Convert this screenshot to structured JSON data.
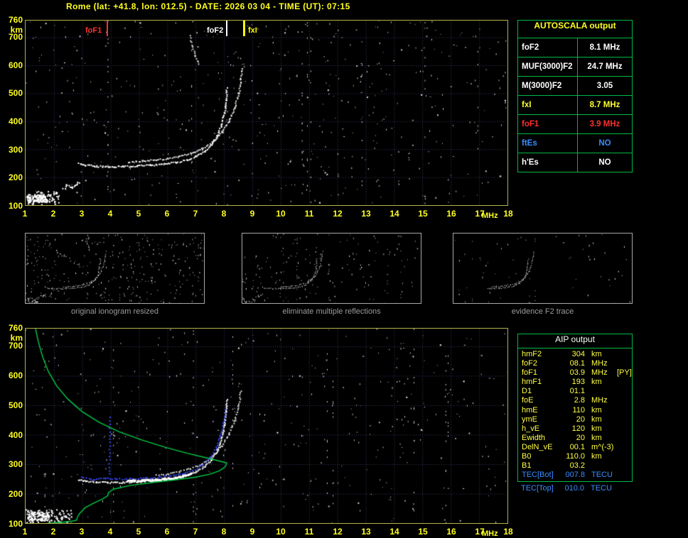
{
  "title": "Rome (lat: +41.8, lon: 012.5) - DATE: 2026 03 04 - TIME (UT): 07:15",
  "colors": {
    "background": "#000000",
    "axis_text": "#ffff21",
    "plot_border": "#b2b24a",
    "grid": "#3a3a66",
    "table_border": "#00b944",
    "caption": "#9c9c9c",
    "trace_white": "#ffffff",
    "trace_blue": "#3b4bff",
    "profile_green": "#00cc44",
    "marker_red": "#ff3030",
    "marker_yellow": "#ffff00",
    "status_blue": "#3a8cff"
  },
  "autoscala_table": {
    "header": "AUTOSCALA output",
    "rows": [
      {
        "label": "foF2",
        "value": "8.1 MHz",
        "color": "#ffffff"
      },
      {
        "label": "MUF(3000)F2",
        "value": "24.7 MHz",
        "color": "#ffffff"
      },
      {
        "label": "M(3000)F2",
        "value": "3.05",
        "color": "#ffffff"
      },
      {
        "label": "fxI",
        "value": "8.7 MHz",
        "color": "#ffff33"
      },
      {
        "label": "foF1",
        "value": "3.9 MHz",
        "color": "#ff3030"
      },
      {
        "label": "ftEs",
        "value": "NO",
        "color": "#3a8cff"
      },
      {
        "label": "h'Es",
        "value": "NO",
        "color": "#ffffff"
      }
    ]
  },
  "aip_table": {
    "header": "AIP output",
    "rows": [
      {
        "name": "hmF2",
        "value": "304",
        "unit": "km"
      },
      {
        "name": "foF2",
        "value": "08.1",
        "unit": "MHz"
      },
      {
        "name": "foF1",
        "value": "03.9",
        "unit": "MHz",
        "note": "[PY]"
      },
      {
        "name": "hmF1",
        "value": "193",
        "unit": "km"
      },
      {
        "name": "D1",
        "value": "01.1",
        "unit": ""
      },
      {
        "name": "foE",
        "value": "2.8",
        "unit": "MHz"
      },
      {
        "name": "hmE",
        "value": "110",
        "unit": "km"
      },
      {
        "name": "ymE",
        "value": "20",
        "unit": "km"
      },
      {
        "name": "h_vE",
        "value": "120",
        "unit": "km"
      },
      {
        "name": "Ewidth",
        "value": "20",
        "unit": "km"
      },
      {
        "name": "DelN_vE",
        "value": "00.1",
        "unit": "m^(-3)"
      },
      {
        "name": "B0",
        "value": "110.0",
        "unit": "km"
      },
      {
        "name": "B1",
        "value": "03.2",
        "unit": ""
      },
      {
        "name": "TEC[Bot]",
        "value": "007.8",
        "unit": "TECU",
        "color": "#3a8cff"
      }
    ],
    "footer_row": {
      "name": "TEC[Top]",
      "value": "010.0",
      "unit": "TECU",
      "color": "#3a8cff"
    }
  },
  "thumbnails": [
    {
      "caption": "original ionogram resized",
      "render": {
        "seed": 11,
        "noise": 300,
        "streaks": 8,
        "exclude_tags": [],
        "min_f": 1,
        "clusters": [
          {
            "f": [
              1.0,
              2.2
            ],
            "h": [
              100,
              150
            ],
            "n": 35,
            "size": 1
          }
        ]
      }
    },
    {
      "caption": "eliminate multiple reflections",
      "render": {
        "seed": 12,
        "noise": 150,
        "streaks": 5,
        "exclude_tags": [
          "echo"
        ],
        "min_f": 1,
        "clusters": [
          {
            "f": [
              1.0,
              2.2
            ],
            "h": [
              100,
              150
            ],
            "n": 18,
            "size": 1
          }
        ]
      }
    },
    {
      "caption": "evidence F2 trace",
      "render": {
        "seed": 13,
        "noise": 55,
        "streaks": 3,
        "exclude_tags": [
          "echo",
          "es"
        ],
        "min_f": 4.2,
        "clusters": []
      }
    }
  ],
  "chart_data": [
    {
      "type": "scatter",
      "name": "scaled ionogram (virtual height vs frequency)",
      "xlabel": "MHz",
      "ylabel": "km",
      "xlim": [
        1,
        18
      ],
      "ylim": [
        100,
        760
      ],
      "x_ticks": [
        1,
        2,
        3,
        4,
        5,
        6,
        7,
        8,
        9,
        10,
        11,
        12,
        13,
        14,
        15,
        16,
        17,
        18
      ],
      "y_ticks": [
        760,
        700,
        600,
        500,
        400,
        300,
        200,
        100
      ],
      "grid": true,
      "markers": [
        {
          "label": "foF1",
          "freq": 3.9,
          "color": "#ff3030",
          "label_dx": -31,
          "width": 2
        },
        {
          "label": "foF2",
          "freq": 8.1,
          "color": "#ffffff",
          "label_dx": -28,
          "width": 2
        },
        {
          "label": "fxI",
          "freq": 8.7,
          "color": "#ffff00",
          "label_dx": 6,
          "width": 3
        }
      ],
      "traces": [
        {
          "tag": "o",
          "name": "F-trace O-mode",
          "color": "#ffffff",
          "size": 2,
          "step": 2.2,
          "jitter": 2,
          "points": [
            [
              2.85,
              250
            ],
            [
              3.1,
              245
            ],
            [
              3.5,
              241
            ],
            [
              3.9,
              239
            ],
            [
              4.4,
              240
            ],
            [
              4.9,
              242
            ],
            [
              5.4,
              245
            ],
            [
              5.9,
              249
            ],
            [
              6.3,
              255
            ],
            [
              6.7,
              264
            ],
            [
              7.0,
              276
            ],
            [
              7.3,
              294
            ],
            [
              7.55,
              318
            ],
            [
              7.75,
              350
            ],
            [
              7.9,
              390
            ],
            [
              8.0,
              435
            ],
            [
              8.05,
              480
            ],
            [
              8.08,
              520
            ]
          ]
        },
        {
          "tag": "x",
          "name": "F-trace X-mode",
          "color": "#e8e8e8",
          "size": 2,
          "step": 2.6,
          "jitter": 2,
          "points": [
            [
              4.6,
              257
            ],
            [
              5.1,
              260
            ],
            [
              5.6,
              264
            ],
            [
              6.0,
              269
            ],
            [
              6.4,
              276
            ],
            [
              6.8,
              287
            ],
            [
              7.2,
              303
            ],
            [
              7.6,
              329
            ],
            [
              7.9,
              364
            ],
            [
              8.15,
              402
            ],
            [
              8.35,
              448
            ],
            [
              8.5,
              500
            ],
            [
              8.58,
              550
            ],
            [
              8.62,
              592
            ]
          ]
        },
        {
          "tag": "echo",
          "name": "second-hop echo",
          "color": "#cccccc",
          "size": 2,
          "step": 3,
          "jitter": 2,
          "points": [
            [
              6.78,
              708
            ],
            [
              6.88,
              668
            ],
            [
              6.98,
              634
            ],
            [
              7.08,
              606
            ]
          ]
        },
        {
          "tag": "es",
          "name": "low-E scatter",
          "color": "#ffffff",
          "size": 2,
          "step": 2.5,
          "jitter": 3,
          "points": [
            [
              2.3,
              158
            ],
            [
              2.45,
              172
            ],
            [
              2.6,
              163
            ],
            [
              2.75,
              176
            ],
            [
              2.9,
              185
            ]
          ]
        }
      ],
      "render": {
        "seed": 7,
        "noise": 520,
        "streaks": 12,
        "clusters": [
          {
            "f": [
              1.0,
              2.2
            ],
            "h": [
              100,
              152
            ],
            "n": 80,
            "size": 2
          },
          {
            "f": [
              1.05,
              1.75
            ],
            "h": [
              112,
              140
            ],
            "n": 110,
            "size": 2
          }
        ]
      }
    },
    {
      "type": "scatter",
      "name": "ionogram with AIP inversion (trace + electron density profile)",
      "xlabel": "MHz",
      "ylabel": "km",
      "xlim": [
        1,
        18
      ],
      "ylim": [
        100,
        760
      ],
      "x_ticks": [
        1,
        2,
        3,
        4,
        5,
        6,
        7,
        8,
        9,
        10,
        11,
        12,
        13,
        14,
        15,
        16,
        17,
        18
      ],
      "y_ticks": [
        760,
        700,
        600,
        500,
        400,
        300,
        200,
        100
      ],
      "grid": true,
      "markers": [],
      "traces": [
        {
          "tag": "o",
          "name": "F-trace O-mode",
          "color": "#ffffff",
          "size": 2,
          "step": 2.2,
          "jitter": 2,
          "points": [
            [
              2.85,
              250
            ],
            [
              3.1,
              245
            ],
            [
              3.5,
              241
            ],
            [
              3.9,
              239
            ],
            [
              4.4,
              240
            ],
            [
              4.9,
              242
            ],
            [
              5.4,
              245
            ],
            [
              5.9,
              249
            ],
            [
              6.3,
              255
            ],
            [
              6.7,
              264
            ],
            [
              7.0,
              276
            ],
            [
              7.3,
              294
            ],
            [
              7.55,
              318
            ],
            [
              7.75,
              350
            ],
            [
              7.9,
              390
            ],
            [
              8.0,
              435
            ],
            [
              8.05,
              480
            ],
            [
              8.08,
              520
            ]
          ]
        },
        {
          "tag": "o2",
          "name": "F-trace thick band",
          "color": "#ffffff",
          "size": 3,
          "step": 2,
          "jitter": 2,
          "points": [
            [
              4.6,
              246
            ],
            [
              5.1,
              248
            ],
            [
              5.6,
              250
            ],
            [
              6.1,
              255
            ],
            [
              6.5,
              262
            ],
            [
              6.8,
              270
            ]
          ]
        },
        {
          "tag": "x",
          "name": "F-trace X-mode",
          "color": "#dddddd",
          "size": 2,
          "step": 3.2,
          "jitter": 2,
          "points": [
            [
              5.6,
              264
            ],
            [
              6.0,
              269
            ],
            [
              6.4,
              276
            ],
            [
              6.8,
              287
            ],
            [
              7.2,
              303
            ],
            [
              7.6,
              329
            ],
            [
              7.9,
              364
            ],
            [
              8.15,
              402
            ],
            [
              8.35,
              448
            ],
            [
              8.5,
              500
            ],
            [
              8.58,
              550
            ]
          ]
        },
        {
          "tag": "blue",
          "name": "autoscaled trace",
          "color": "#3b4bff",
          "size": 2,
          "step": 3.5,
          "jitter": 2,
          "points": [
            [
              2.95,
              256
            ],
            [
              3.4,
              250
            ],
            [
              3.8,
              254
            ],
            [
              4.2,
              251
            ],
            [
              4.7,
              252
            ],
            [
              5.2,
              254
            ],
            [
              5.7,
              258
            ],
            [
              6.2,
              263
            ],
            [
              6.6,
              272
            ],
            [
              6.95,
              284
            ],
            [
              7.25,
              300
            ],
            [
              7.5,
              326
            ],
            [
              7.7,
              358
            ],
            [
              7.85,
              398
            ],
            [
              7.97,
              442
            ],
            [
              8.04,
              486
            ]
          ]
        },
        {
          "tag": "blue-spike",
          "name": "F1 cusp spike",
          "color": "#3b4bff",
          "size": 2,
          "step": 5,
          "jitter": 1.5,
          "points": [
            [
              3.93,
              268
            ],
            [
              3.96,
              460
            ]
          ]
        }
      ],
      "profile": {
        "name": "electron density profile N(h)",
        "color": "#00cc44",
        "points": [
          [
            1.35,
            760
          ],
          [
            1.45,
            715
          ],
          [
            1.6,
            665
          ],
          [
            1.8,
            615
          ],
          [
            2.1,
            565
          ],
          [
            2.5,
            520
          ],
          [
            3.0,
            478
          ],
          [
            3.6,
            442
          ],
          [
            4.3,
            410
          ],
          [
            5.1,
            382
          ],
          [
            5.9,
            358
          ],
          [
            6.7,
            337
          ],
          [
            7.4,
            321
          ],
          [
            7.9,
            309
          ],
          [
            8.1,
            304
          ],
          [
            8.05,
            292
          ],
          [
            7.85,
            278
          ],
          [
            7.5,
            266
          ],
          [
            7.0,
            256
          ],
          [
            6.3,
            247
          ],
          [
            5.5,
            238
          ],
          [
            4.7,
            228
          ],
          [
            4.1,
            215
          ],
          [
            3.92,
            203
          ],
          [
            3.9,
            193
          ],
          [
            3.7,
            181
          ],
          [
            3.4,
            168
          ],
          [
            3.1,
            152
          ],
          [
            2.9,
            132
          ],
          [
            2.82,
            118
          ],
          [
            2.8,
            110
          ],
          [
            2.6,
            106
          ],
          [
            2.3,
            103
          ],
          [
            1.9,
            100
          ],
          [
            1.4,
            96
          ],
          [
            1.0,
            93
          ]
        ]
      },
      "render": {
        "seed": 21,
        "noise": 430,
        "streaks": 10,
        "clusters": [
          {
            "f": [
              1.0,
              2.6
            ],
            "h": [
              100,
              150
            ],
            "n": 90,
            "size": 2
          },
          {
            "f": [
              1.05,
              1.8
            ],
            "h": [
              110,
              140
            ],
            "n": 120,
            "size": 2
          }
        ]
      }
    }
  ]
}
